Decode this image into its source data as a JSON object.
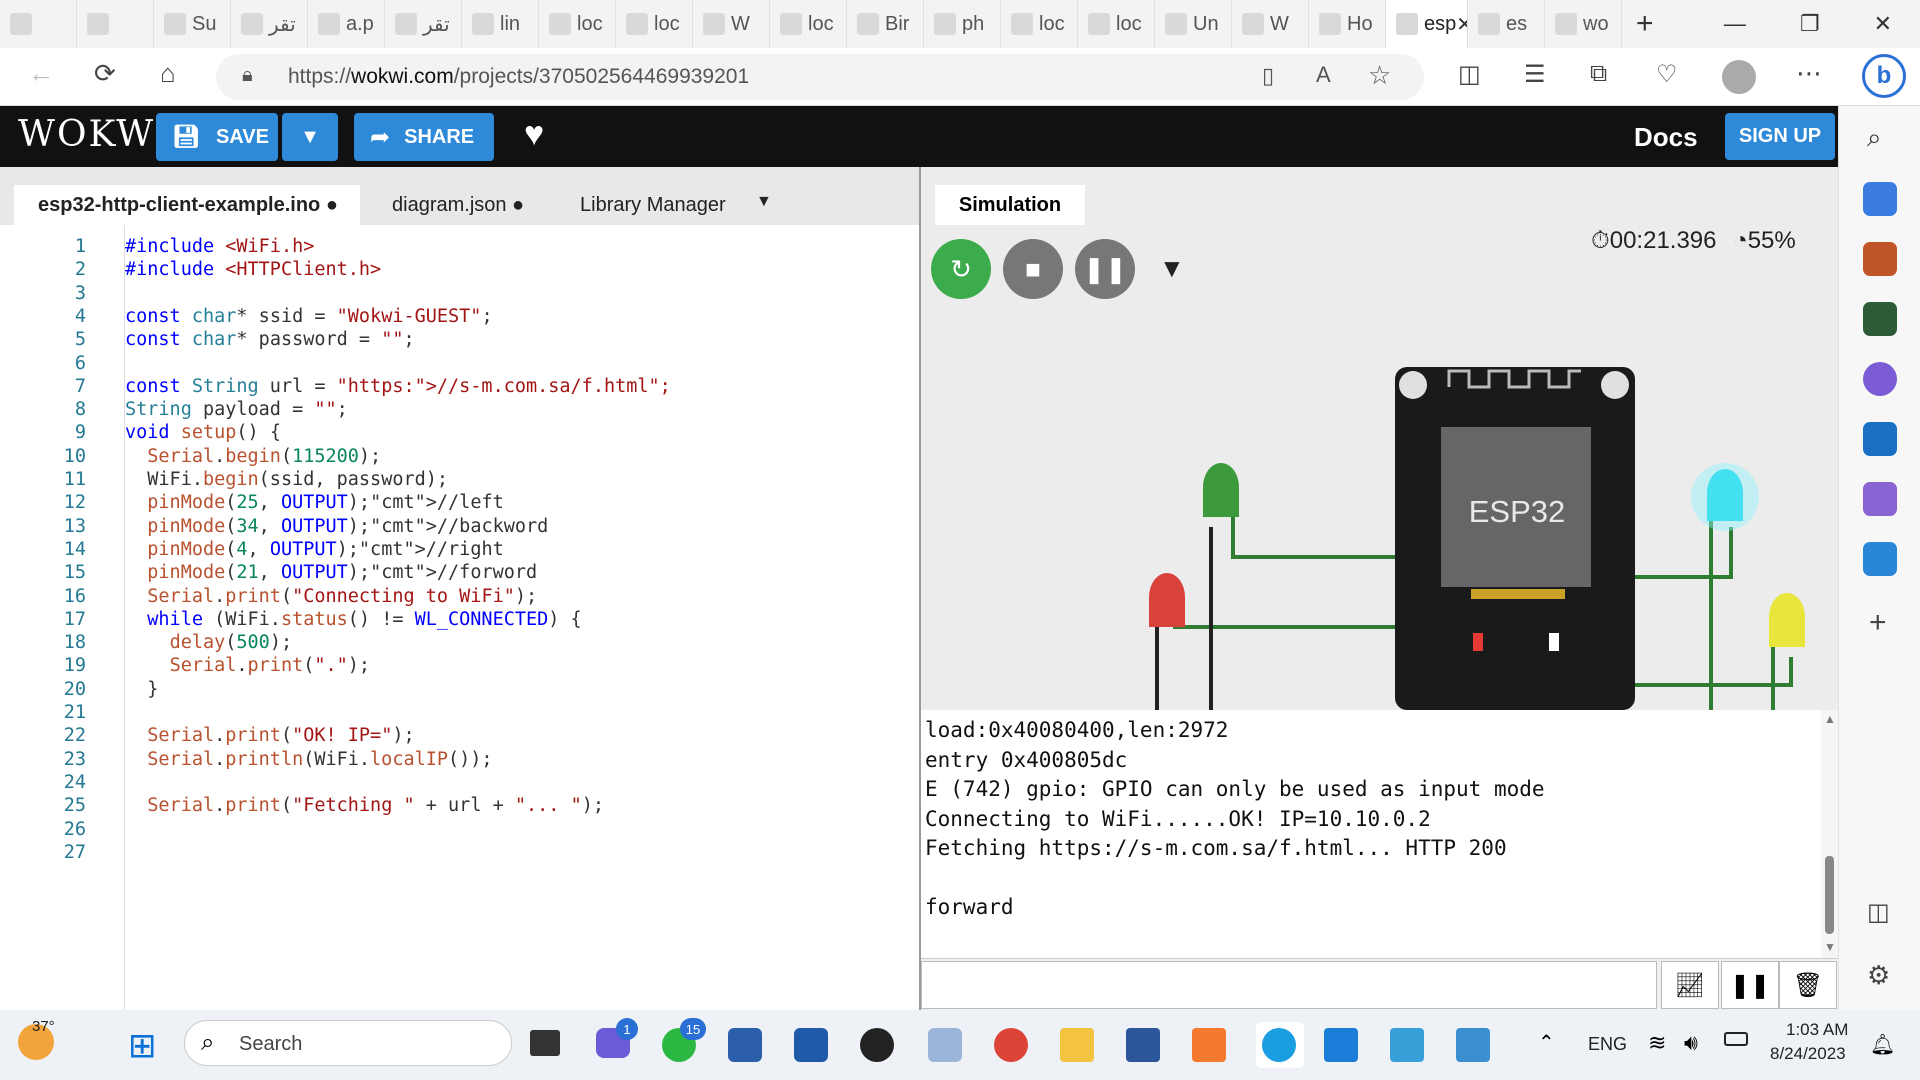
{
  "browser": {
    "tabs": [
      {
        "label": "",
        "icon": "tab-actions-icon"
      },
      {
        "label": "",
        "icon": "workspaces-icon"
      },
      {
        "label": "Su",
        "icon": "pdf-icon"
      },
      {
        "label": "تقر",
        "icon": "pdf-icon"
      },
      {
        "label": "a.p",
        "icon": "pdf-icon"
      },
      {
        "label": "تقر",
        "icon": "pdf-icon"
      },
      {
        "label": "lin",
        "icon": "file-icon"
      },
      {
        "label": "loc",
        "icon": "phpmyadmin-icon"
      },
      {
        "label": "loc",
        "icon": "phpmyadmin-icon"
      },
      {
        "label": "W",
        "icon": "xampp-icon"
      },
      {
        "label": "loc",
        "icon": "xampp-icon"
      },
      {
        "label": "Bir",
        "icon": "search-icon"
      },
      {
        "label": "ph",
        "icon": "stackoverflow-icon"
      },
      {
        "label": "loc",
        "icon": "xampp-icon"
      },
      {
        "label": "loc",
        "icon": "phpmyadmin-icon"
      },
      {
        "label": "Un",
        "icon": "search-icon"
      },
      {
        "label": "W",
        "icon": "stackoverflow-icon"
      },
      {
        "label": "Ho",
        "icon": "youtube-icon"
      },
      {
        "label": "esp",
        "icon": "wokwi-icon",
        "active": true
      },
      {
        "label": "es",
        "icon": "wokwi-w-icon"
      },
      {
        "label": "wo",
        "icon": "wokwi-w-icon"
      }
    ],
    "url_prefix": "https://",
    "url_domain": "wokwi.com",
    "url_path": "/projects/370502564469939201"
  },
  "wokwi": {
    "logo": "WOKWI",
    "save_label": "SAVE",
    "share_label": "SHARE",
    "docs_label": "Docs",
    "signup_label": "SIGN UP"
  },
  "editor": {
    "tabs": [
      {
        "label": "esp32-http-client-example.ino ●"
      },
      {
        "label": "diagram.json ●"
      },
      {
        "label": "Library Manager"
      }
    ],
    "lines": [
      "#include <WiFi.h>",
      "#include <HTTPClient.h>",
      "",
      "const char* ssid = \"Wokwi-GUEST\";",
      "const char* password = \"\";",
      "",
      "const String url = \"https://s-m.com.sa/f.html\";",
      "String payload = \"\";",
      "void setup() {",
      "  Serial.begin(115200);",
      "  WiFi.begin(ssid, password);",
      "  pinMode(25, OUTPUT);//left",
      "  pinMode(34, OUTPUT);//backword",
      "  pinMode(4, OUTPUT);//right",
      "  pinMode(21, OUTPUT);//forword",
      "  Serial.print(\"Connecting to WiFi\");",
      "  while (WiFi.status() != WL_CONNECTED) {",
      "    delay(500);",
      "    Serial.print(\".\");",
      "  }",
      "",
      "  Serial.print(\"OK! IP=\");",
      "  Serial.println(WiFi.localIP());",
      "",
      "  Serial.print(\"Fetching \" + url + \"... \");",
      "",
      ""
    ]
  },
  "simulation": {
    "tab_label": "Simulation",
    "timer": "00:21.396",
    "speed": "55%",
    "chip_label": "ESP32"
  },
  "serial": {
    "lines": [
      "load:0x40080400,len:2972",
      "entry 0x400805dc",
      "E (742) gpio: GPIO can only be used as input mode",
      "Connecting to WiFi......OK! IP=10.10.0.2",
      "Fetching https://s-m.com.sa/f.html... HTTP 200",
      "",
      "forward"
    ]
  },
  "taskbar": {
    "weather": "37°",
    "search_placeholder": "Search",
    "lang": "ENG",
    "time": "1:03 AM",
    "date": "8/24/2023",
    "badge_teams": "1",
    "badge_whatsapp": "15"
  }
}
